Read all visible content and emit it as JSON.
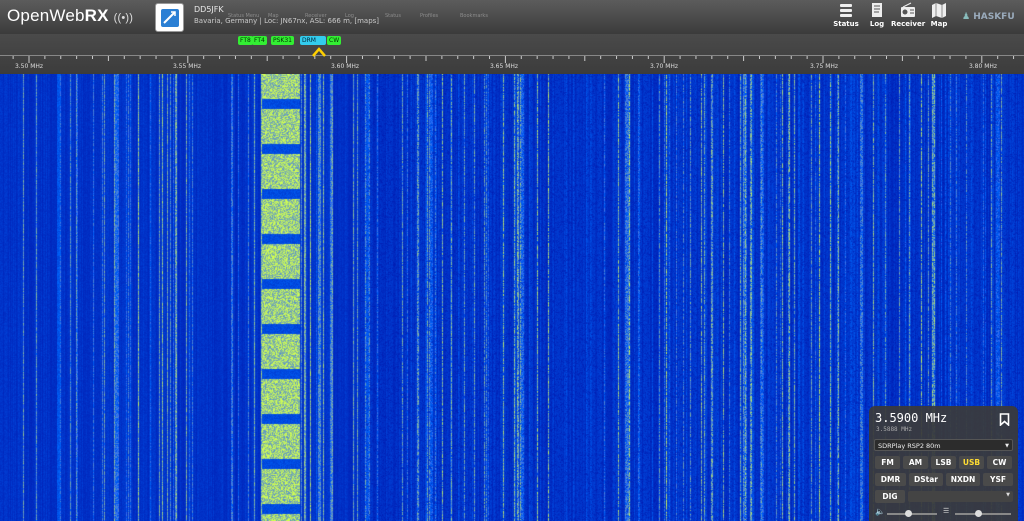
{
  "header": {
    "logo_text": "OpenWeb",
    "logo_bold": "RX",
    "receiver_name": "DD5JFK",
    "receiver_location": "Bavaria, Germany | Loc: JN67nx, ASL: 666 m, [maps]",
    "ghost_tabs": [
      "Status Menu",
      "Map",
      "Receiver",
      "Log",
      "Status",
      "Profiles",
      "Bookmarks"
    ],
    "nav": [
      {
        "label": "Status",
        "icon": "status-icon"
      },
      {
        "label": "Log",
        "icon": "log-icon"
      },
      {
        "label": "Receiver",
        "icon": "receiver-icon"
      },
      {
        "label": "Map",
        "icon": "map-icon"
      }
    ],
    "brand": "HASKFU"
  },
  "scale": {
    "ticks": [
      {
        "label": "3.50 MHz"
      },
      {
        "label": "3.55 MHz"
      },
      {
        "label": "3.60 MHz"
      },
      {
        "label": "3.65 MHz"
      },
      {
        "label": "3.70 MHz"
      },
      {
        "label": "3.75 MHz"
      },
      {
        "label": "3.80 MHz"
      }
    ],
    "bookmarks": [
      {
        "label": "FT8",
        "color": "#33ee33"
      },
      {
        "label": "FT4",
        "color": "#33ee33"
      },
      {
        "label": "PSK31",
        "color": "#33ee33"
      },
      {
        "label": "CW",
        "color": "#33ee33"
      },
      {
        "label": "DRM",
        "color": "#33ccee"
      }
    ]
  },
  "panel": {
    "frequency": "3.5900 MHz",
    "sub_frequency": "3.5888 MHz",
    "profile": "SDRPlay RSP2 80m",
    "modes_row1": [
      "FM",
      "AM",
      "LSB",
      "USB",
      "CW"
    ],
    "modes_row2": [
      "DMR",
      "DStar",
      "NXDN",
      "YSF"
    ],
    "modes_row3": [
      "DIG"
    ],
    "active_mode": "USB",
    "colors": {
      "active_mode": "#ffdd33",
      "panel_bg": "#3a3a3a"
    }
  },
  "colors": {
    "waterfall_base": "#0a27c8",
    "signal_strong": "#aaff55",
    "header_bg": "#4a4a4a"
  }
}
